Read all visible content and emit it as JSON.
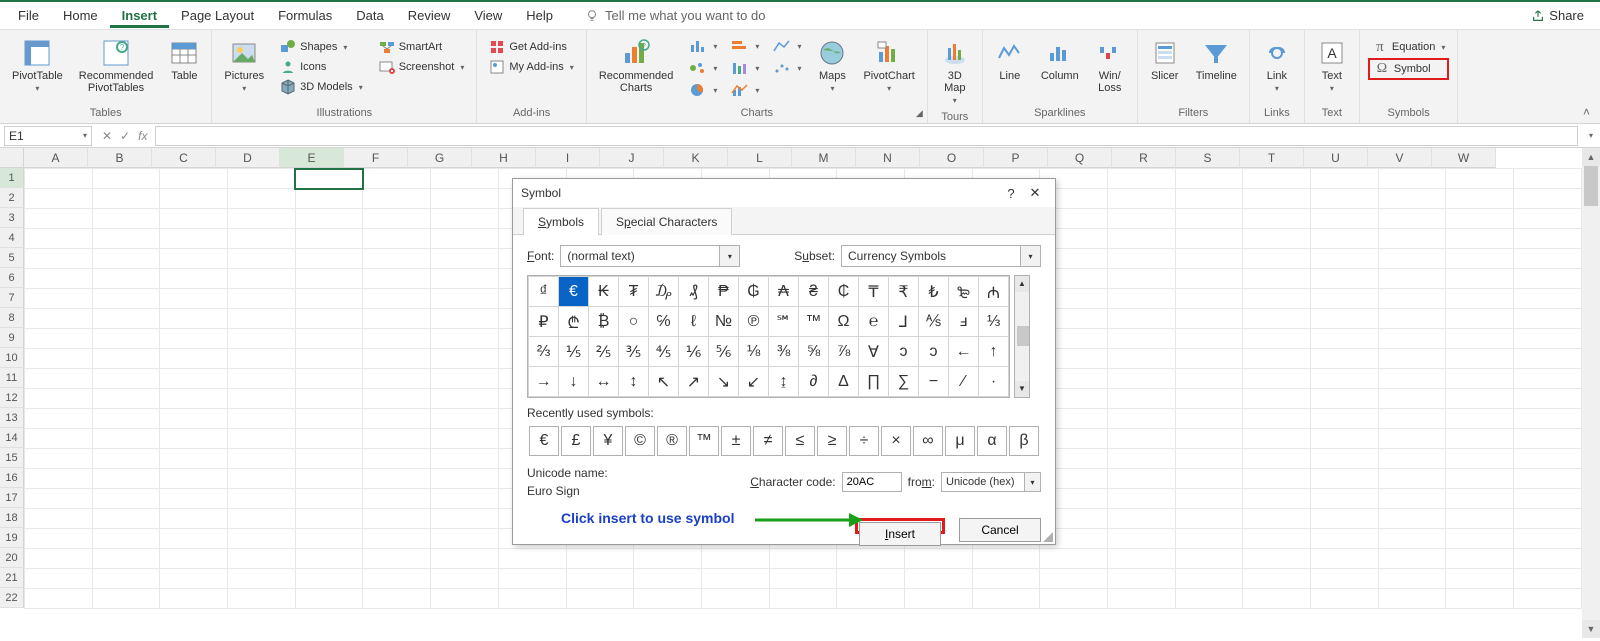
{
  "menubar": {
    "items": [
      "File",
      "Home",
      "Insert",
      "Page Layout",
      "Formulas",
      "Data",
      "Review",
      "View",
      "Help"
    ],
    "active_index": 2,
    "tell_me": "Tell me what you want to do",
    "share": "Share"
  },
  "ribbon": {
    "groups": {
      "tables": {
        "label": "Tables",
        "pivot": "PivotTable",
        "recommended": "Recommended\nPivotTables",
        "table": "Table"
      },
      "illustrations": {
        "label": "Illustrations",
        "pictures": "Pictures",
        "shapes": "Shapes",
        "icons": "Icons",
        "models": "3D Models",
        "smartart": "SmartArt",
        "screenshot": "Screenshot"
      },
      "addins": {
        "label": "Add-ins",
        "get": "Get Add-ins",
        "my": "My Add-ins"
      },
      "charts": {
        "label": "Charts",
        "recommended": "Recommended\nCharts",
        "maps": "Maps",
        "pivotchart": "PivotChart"
      },
      "tours": {
        "label": "Tours",
        "map": "3D\nMap"
      },
      "sparklines": {
        "label": "Sparklines",
        "line": "Line",
        "column": "Column",
        "winloss": "Win/\nLoss"
      },
      "filters": {
        "label": "Filters",
        "slicer": "Slicer",
        "timeline": "Timeline"
      },
      "links": {
        "label": "Links",
        "link": "Link"
      },
      "text": {
        "label": "Text",
        "text": "Text"
      },
      "symbols": {
        "label": "Symbols",
        "equation": "Equation",
        "symbol": "Symbol"
      }
    }
  },
  "namebox": "E1",
  "grid": {
    "cols": [
      "A",
      "B",
      "C",
      "D",
      "E",
      "F",
      "G",
      "",
      "",
      "",
      "",
      "",
      "",
      "",
      "",
      "Q",
      "R",
      "S",
      "T",
      "U",
      "V",
      "W"
    ],
    "visible_cols_skip_start": 7,
    "rows": 22,
    "active": {
      "r": 1,
      "c": 5
    }
  },
  "dialog": {
    "title": "Symbol",
    "tabs": [
      "Symbols",
      "Special Characters"
    ],
    "font_label": "Font:",
    "font_value": "(normal text)",
    "subset_label": "Subset:",
    "subset_value": "Currency Symbols",
    "grid": [
      [
        "₫",
        "€",
        "₭",
        "₮",
        "₯",
        "₰",
        "₱",
        "₲",
        "₳",
        "₴",
        "₵",
        "₸",
        "₹",
        "₺",
        "₻",
        "₼"
      ],
      [
        "₽",
        "₾",
        "₿",
        "○",
        "℅",
        "ℓ",
        "№",
        "℗",
        "℠",
        "™",
        "Ω",
        "℮",
        "⅃",
        "⅍",
        "ⅎ",
        "⅓"
      ],
      [
        "⅔",
        "⅕",
        "⅖",
        "⅗",
        "⅘",
        "⅙",
        "⅚",
        "⅛",
        "⅜",
        "⅝",
        "⅞",
        "Ɐ",
        "ↄ",
        "ↄ",
        "←",
        "↑"
      ],
      [
        "→",
        "↓",
        "↔",
        "↕",
        "↖",
        "↗",
        "↘",
        "↙",
        "↨",
        "∂",
        "Δ",
        "∏",
        "∑",
        "−",
        "∕",
        "·"
      ]
    ],
    "selected": {
      "r": 0,
      "c": 1
    },
    "recent_label": "Recently used symbols:",
    "recent": [
      "€",
      "£",
      "¥",
      "©",
      "®",
      "™",
      "±",
      "≠",
      "≤",
      "≥",
      "÷",
      "×",
      "∞",
      "μ",
      "α",
      "β"
    ],
    "unicode_name_label": "Unicode name:",
    "unicode_name": "Euro Sign",
    "char_code_label": "Character code:",
    "char_code": "20AC",
    "from_label": "from:",
    "from_value": "Unicode (hex)",
    "instruction": "Click insert to use symbol",
    "insert": "Insert",
    "cancel": "Cancel"
  }
}
